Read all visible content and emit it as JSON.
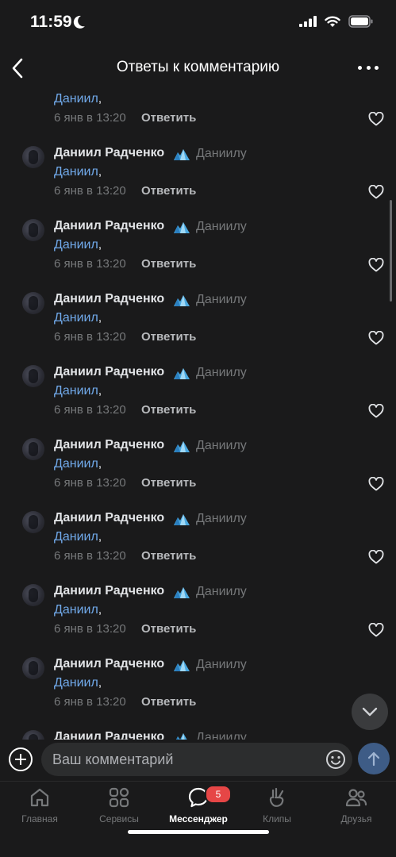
{
  "status_bar": {
    "time": "11:59"
  },
  "header": {
    "title": "Ответы к комментарию"
  },
  "partial_top": {
    "mention": "Даниил",
    "time": "6 янв в 13:20",
    "reply_label": "Ответить"
  },
  "comments": [
    {
      "author": "Даниил Радченко",
      "reply_to": "Даниилу",
      "mention": "Даниил",
      "time": "6 янв в 13:20",
      "reply_label": "Ответить"
    },
    {
      "author": "Даниил Радченко",
      "reply_to": "Даниилу",
      "mention": "Даниил",
      "time": "6 янв в 13:20",
      "reply_label": "Ответить"
    },
    {
      "author": "Даниил Радченко",
      "reply_to": "Даниилу",
      "mention": "Даниил",
      "time": "6 янв в 13:20",
      "reply_label": "Ответить"
    },
    {
      "author": "Даниил Радченко",
      "reply_to": "Даниилу",
      "mention": "Даниил",
      "time": "6 янв в 13:20",
      "reply_label": "Ответить"
    },
    {
      "author": "Даниил Радченко",
      "reply_to": "Даниилу",
      "mention": "Даниил",
      "time": "6 янв в 13:20",
      "reply_label": "Ответить"
    },
    {
      "author": "Даниил Радченко",
      "reply_to": "Даниилу",
      "mention": "Даниил",
      "time": "6 янв в 13:20",
      "reply_label": "Ответить"
    },
    {
      "author": "Даниил Радченко",
      "reply_to": "Даниилу",
      "mention": "Даниил",
      "time": "6 янв в 13:20",
      "reply_label": "Ответить"
    },
    {
      "author": "Даниил Радченко",
      "reply_to": "Даниилу",
      "mention": "Даниил",
      "time": "6 янв в 13:20",
      "reply_label": "Ответить"
    }
  ],
  "partial_bottom": {
    "author": "Даниил Радченко",
    "reply_to": "Даниилу"
  },
  "composer": {
    "placeholder": "Ваш комментарий"
  },
  "tabs": [
    {
      "label": "Главная",
      "icon": "home-icon"
    },
    {
      "label": "Сервисы",
      "icon": "services-icon"
    },
    {
      "label": "Мессенджер",
      "icon": "messenger-icon",
      "badge": "5"
    },
    {
      "label": "Клипы",
      "icon": "clips-icon"
    },
    {
      "label": "Друзья",
      "icon": "friends-icon"
    }
  ],
  "colors": {
    "background": "#1a1a1b",
    "link": "#71aaeb",
    "secondary": "#76787a",
    "badge": "#e64646",
    "send": "#3e5c86"
  }
}
